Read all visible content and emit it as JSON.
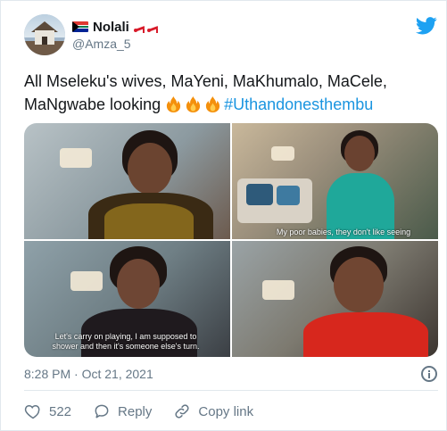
{
  "author": {
    "display_name": "Nolali",
    "handle": "@Amza_5",
    "flag_icon": "south-africa-flag-icon",
    "emoji_icon": "high-heel-shoes-icon"
  },
  "tweet": {
    "text": "All Mseleku's wives, MaYeni, MaKhumalo, MaCele, MaNgwabe looking ",
    "emoji_icon": "fire-icon",
    "emoji_count": 3,
    "hashtag": "#Uthandonesthembu"
  },
  "media": {
    "captions": {
      "tile2": "My poor babies, they don't like seeing",
      "tile3": "Let's carry on playing, I am supposed to shower and then it's someone else's turn."
    }
  },
  "meta": {
    "timestamp": "8:28 PM · Oct 21, 2021"
  },
  "actions": {
    "likes_count": "522",
    "reply_label": "Reply",
    "copy_link_label": "Copy link"
  },
  "colors": {
    "brand": "#1da1f2",
    "hashtag": "#1b95e0",
    "muted": "#657786",
    "text": "#14171a"
  }
}
